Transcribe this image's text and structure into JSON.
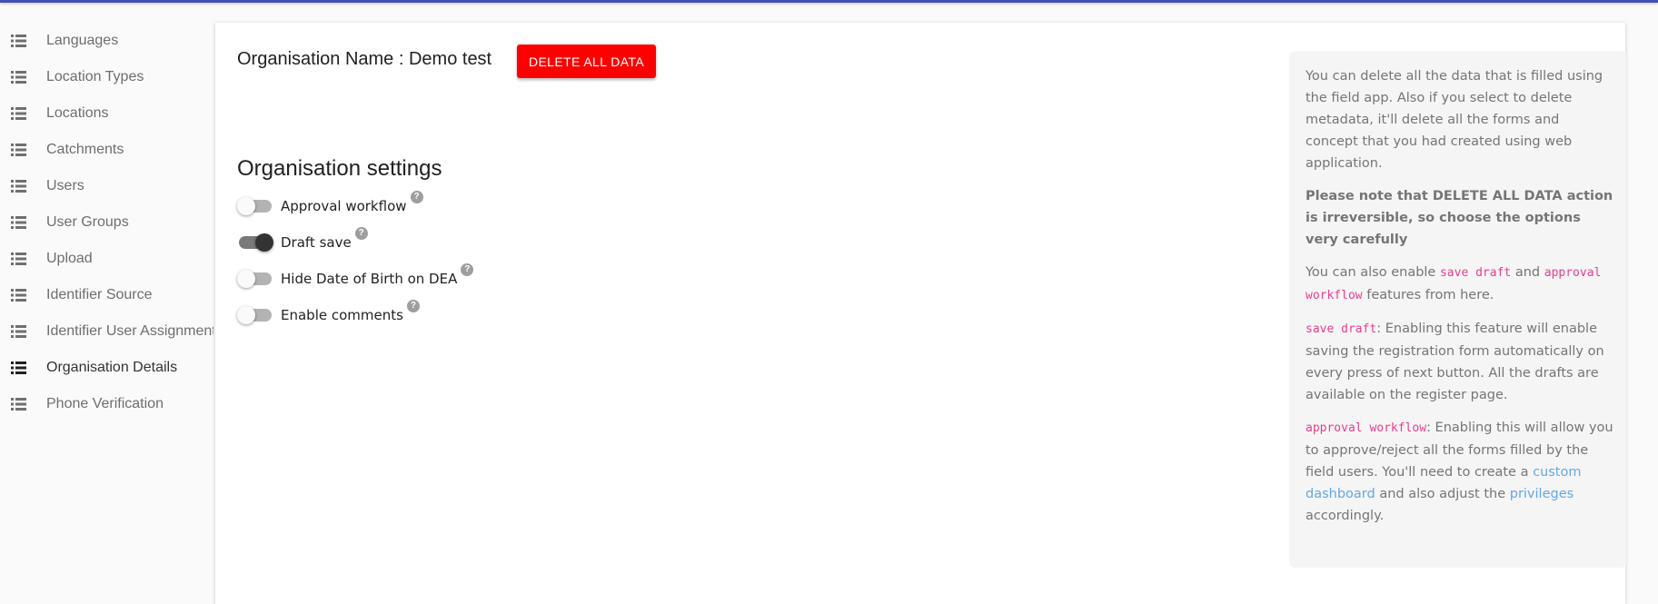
{
  "sidebar": {
    "items": [
      {
        "label": "Languages"
      },
      {
        "label": "Location Types"
      },
      {
        "label": "Locations"
      },
      {
        "label": "Catchments"
      },
      {
        "label": "Users"
      },
      {
        "label": "User Groups"
      },
      {
        "label": "Upload"
      },
      {
        "label": "Identifier Source"
      },
      {
        "label": "Identifier User Assignment"
      },
      {
        "label": "Organisation Details"
      },
      {
        "label": "Phone Verification"
      }
    ],
    "active_index": 9
  },
  "main": {
    "org_name": "Organisation Name : Demo test",
    "delete_button_label": "DELETE ALL DATA",
    "settings_title": "Organisation settings",
    "settings": [
      {
        "label": "Approval workflow",
        "enabled": false,
        "help": "?"
      },
      {
        "label": "Draft save",
        "enabled": true,
        "help": "?"
      },
      {
        "label": "Hide Date of Birth on DEA",
        "enabled": false,
        "help": "?"
      },
      {
        "label": "Enable comments",
        "enabled": false,
        "help": "?"
      }
    ]
  },
  "info": {
    "p1": "You can delete all the data that is filled using the field app. Also if you select to delete metadata, it'll delete all the forms and concept that you had created using web application.",
    "p2": "Please note that DELETE ALL DATA action is irreversible, so choose the options very carefully",
    "p3_a": "You can also enable ",
    "p3_code1": "save draft",
    "p3_b": " and ",
    "p3_code2": "approval workflow",
    "p3_c": " features from here.",
    "p4_code": "save draft",
    "p4_text": ": Enabling this feature will enable saving the registration form automatically on every press of next button. All the drafts are available on the register page.",
    "p5_code": "approval workflow",
    "p5_a": ": Enabling this will allow you to approve/reject all the forms filled by the field users. You'll need to create a ",
    "p5_link1": "custom dashboard",
    "p5_b": " and also adjust the ",
    "p5_link2": "privileges",
    "p5_c": " accordingly."
  },
  "colors": {
    "accent": "#3f51b5",
    "delete": "#ff0000",
    "code": "#e83e8c",
    "link": "#64a8e6"
  }
}
